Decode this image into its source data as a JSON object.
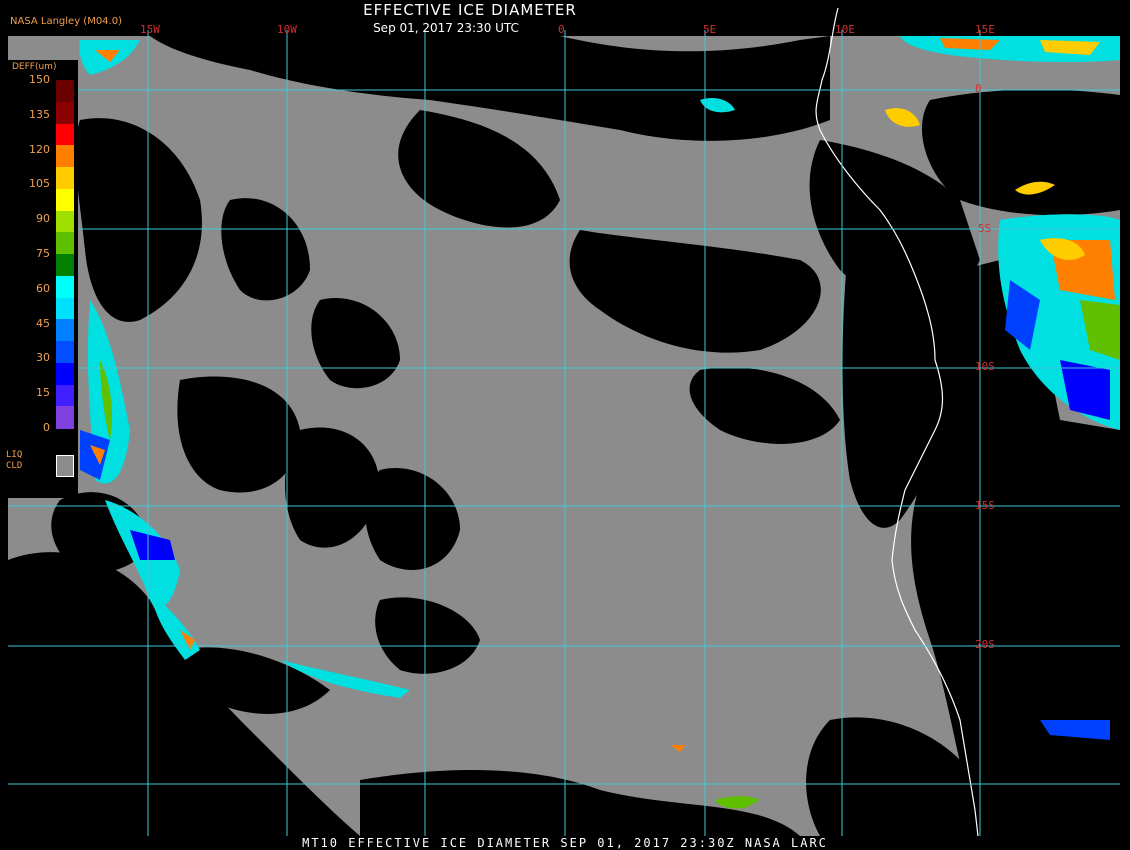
{
  "header": {
    "title": "EFFECTIVE ICE DIAMETER",
    "subtitle": "Sep 01, 2017 23:30 UTC",
    "agency": "NASA Langley (M04.0)"
  },
  "grid": {
    "longitudes": [
      "15W",
      "10W",
      "0",
      "5E",
      "10E",
      "15E"
    ],
    "latitudes": [
      "0",
      "5S",
      "10S",
      "15S",
      "20S"
    ]
  },
  "legend": {
    "title": "DEFF(um)",
    "ticks": [
      "150",
      "135",
      "120",
      "105",
      "90",
      "75",
      "60",
      "45",
      "30",
      "15",
      "0"
    ],
    "colors": [
      "#6a0000",
      "#8b0000",
      "#ff0000",
      "#ff8000",
      "#ffcc00",
      "#ffff00",
      "#a0e000",
      "#60c000",
      "#008000",
      "#00ffff",
      "#00e0ff",
      "#0080ff",
      "#0050ff",
      "#0000ff",
      "#4020ff",
      "#8040e0"
    ],
    "liquid_label_1": "LIQ",
    "liquid_label_2": "CLD",
    "liquid_color": "#8c8c8c"
  },
  "colors": {
    "cloud": "#8c8c8c",
    "clear": "#000000",
    "grid": "#40c8d8",
    "coast": "#ffffff",
    "labels": "#d23030"
  },
  "footer": {
    "text": "MT10  EFFECTIVE ICE DIAMETER   SEP 01, 2017 23:30Z   NASA LARC"
  }
}
